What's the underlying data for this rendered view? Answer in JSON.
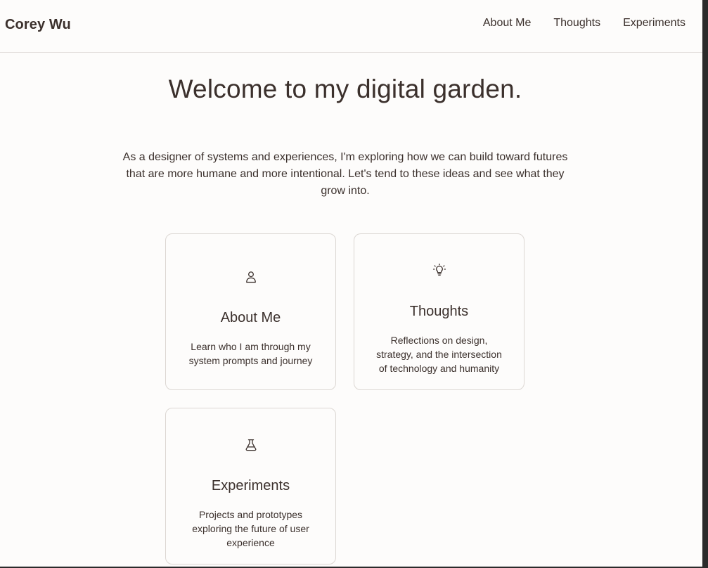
{
  "header": {
    "brand": "Corey Wu",
    "nav": [
      {
        "label": "About Me"
      },
      {
        "label": "Thoughts"
      },
      {
        "label": "Experiments"
      }
    ]
  },
  "hero": {
    "title": "Welcome to my digital garden.",
    "intro": "As a designer of systems and experiences, I'm exploring how we can build toward futures that are more humane and more intentional. Let's tend to these ideas and see what they grow into."
  },
  "cards": [
    {
      "icon": "person-icon",
      "title": "About Me",
      "description": "Learn who I am through my system prompts and journey"
    },
    {
      "icon": "lightbulb-icon",
      "title": "Thoughts",
      "description": "Reflections on design, strategy, and the intersection of technology and humanity"
    },
    {
      "icon": "flask-icon",
      "title": "Experiments",
      "description": "Projects and prototypes exploring the future of user experience"
    }
  ],
  "colors": {
    "background": "#fdfcfb",
    "text": "#3b302c",
    "border": "#dcd7d3"
  }
}
